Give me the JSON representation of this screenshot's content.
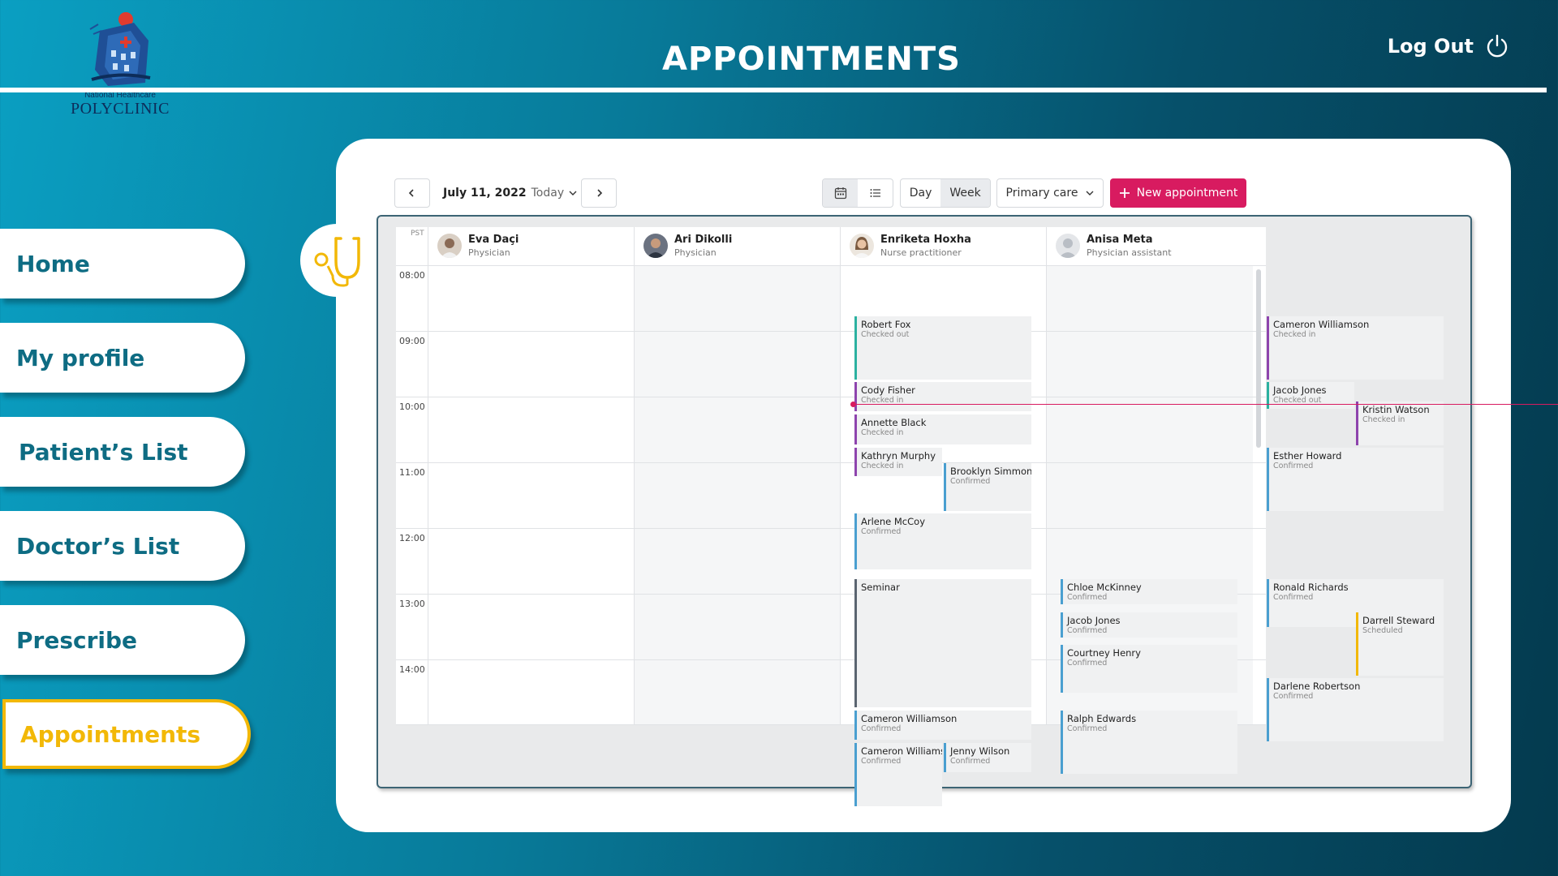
{
  "header": {
    "title": "APPOINTMENTS",
    "logout_label": "Log Out",
    "logo_small": "National Healthcare",
    "logo_big": "POLYCLINIC"
  },
  "nav": {
    "items": [
      {
        "label": "Home"
      },
      {
        "label": "My profile"
      },
      {
        "label": "Patient’s List"
      },
      {
        "label": "Doctor’s List"
      },
      {
        "label": "Prescribe"
      },
      {
        "label": "Appointments"
      }
    ]
  },
  "toolbar": {
    "date": "July 11, 2022",
    "today": "Today",
    "view_day": "Day",
    "view_week": "Week",
    "filter": "Primary care",
    "new_appointment": "New appointment"
  },
  "calendar": {
    "timezone": "PST",
    "hours": [
      "08:00",
      "09:00",
      "10:00",
      "11:00",
      "12:00",
      "13:00",
      "14:00"
    ],
    "resources": [
      {
        "name": "Eva Daçi",
        "role": "Physician"
      },
      {
        "name": "Ari Dikolli",
        "role": "Physician"
      },
      {
        "name": "Enriketa Hoxha",
        "role": "Nurse practitioner"
      },
      {
        "name": "Anisa Meta",
        "role": "Physician assistant"
      }
    ],
    "appointments": [
      {
        "name": "Robert Fox",
        "status": "Checked out"
      },
      {
        "name": "Cody Fisher",
        "status": "Checked in"
      },
      {
        "name": "Annette Black",
        "status": "Checked in"
      },
      {
        "name": "Kathryn Murphy",
        "status": "Checked in"
      },
      {
        "name": "Brooklyn Simmons",
        "status": "Confirmed"
      },
      {
        "name": "Arlene McCoy",
        "status": "Confirmed"
      },
      {
        "name": "Seminar",
        "status": ""
      },
      {
        "name": "Cameron Williamson",
        "status": "Confirmed"
      },
      {
        "name": "Cameron Williamson",
        "status": "Confirmed"
      },
      {
        "name": "Jenny Wilson",
        "status": "Confirmed"
      },
      {
        "name": "Chloe McKinney",
        "status": "Confirmed"
      },
      {
        "name": "Jacob Jones",
        "status": "Confirmed"
      },
      {
        "name": "Courtney Henry",
        "status": "Confirmed"
      },
      {
        "name": "Ralph Edwards",
        "status": "Confirmed"
      },
      {
        "name": "Cameron Williamson",
        "status": "Checked in"
      },
      {
        "name": "Jacob Jones",
        "status": "Checked out"
      },
      {
        "name": "Kristin Watson",
        "status": "Checked in"
      },
      {
        "name": "Esther Howard",
        "status": "Confirmed"
      },
      {
        "name": "Ronald Richards",
        "status": "Confirmed"
      },
      {
        "name": "Darrell Steward",
        "status": "Scheduled"
      },
      {
        "name": "Darlene Robertson",
        "status": "Confirmed"
      }
    ]
  },
  "colors": {
    "checked_out": "#2bb1a0",
    "checked_in": "#8e44ad",
    "confirmed": "#4a9fd0",
    "scheduled": "#f2b807",
    "seminar": "#5a6470",
    "accent": "#d81b60",
    "active_nav": "#f2b807"
  }
}
